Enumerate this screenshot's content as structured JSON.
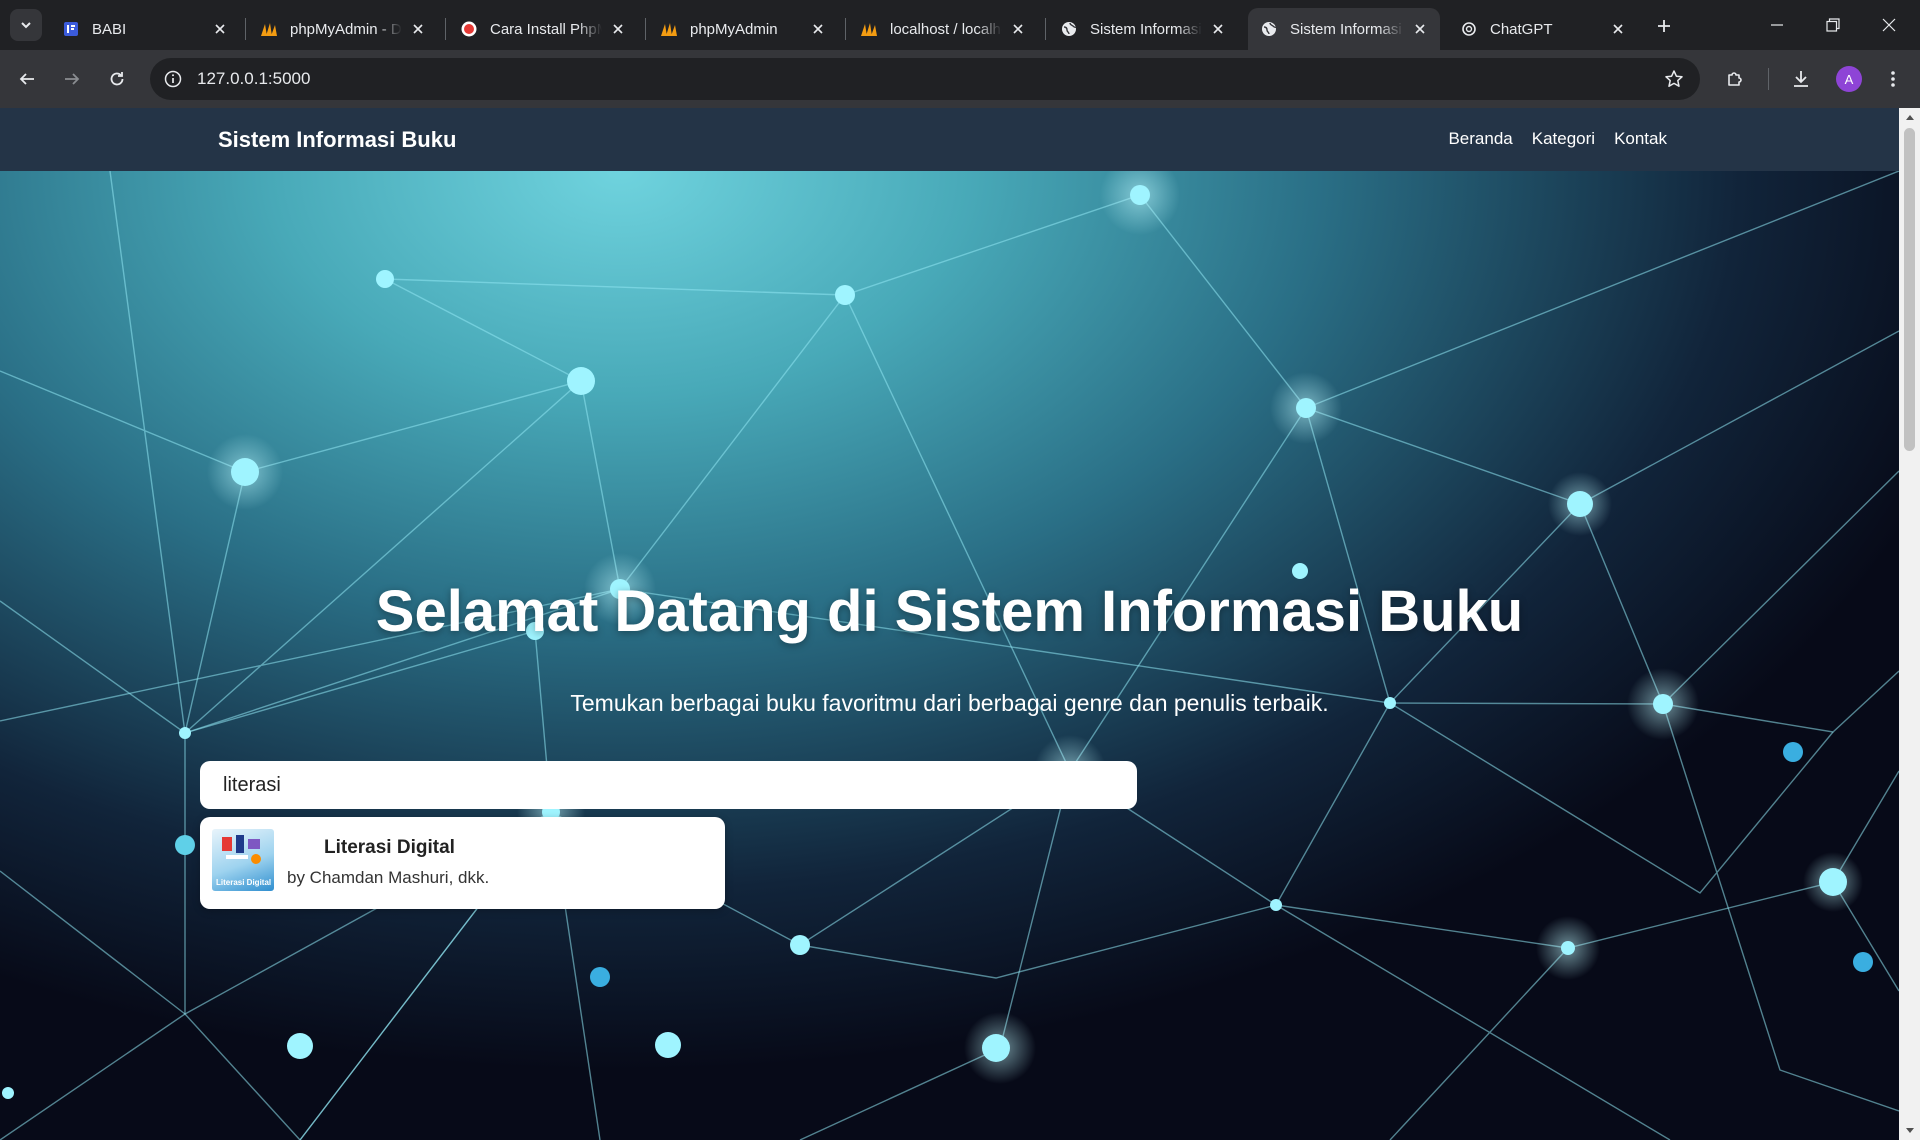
{
  "browser": {
    "tabs": [
      {
        "title": "BABI",
        "favicon": "babi-favicon",
        "active": false
      },
      {
        "title": "phpMyAdmin - D",
        "favicon": "phpmyadmin-favicon",
        "active": false
      },
      {
        "title": "Cara Install PhpMyAdmin",
        "favicon": "article-favicon",
        "active": false
      },
      {
        "title": "phpMyAdmin",
        "favicon": "phpmyadmin-favicon",
        "active": false
      },
      {
        "title": "localhost / localhost",
        "favicon": "phpmyadmin-favicon",
        "active": false
      },
      {
        "title": "Sistem Informasi Buku",
        "favicon": "globe-icon",
        "active": false
      },
      {
        "title": "Sistem Informasi Buku",
        "favicon": "globe-icon",
        "active": true
      },
      {
        "title": "ChatGPT",
        "favicon": "chatgpt-favicon",
        "active": false
      }
    ],
    "url": "127.0.0.1:5000",
    "profile_initial": "A"
  },
  "navbar": {
    "brand": "Sistem Informasi Buku",
    "links": [
      "Beranda",
      "Kategori",
      "Kontak"
    ]
  },
  "hero": {
    "title": "Selamat Datang di Sistem Informasi Buku",
    "subtitle": "Temukan berbagai buku favoritmu dari berbagai genre dan penulis terbaik."
  },
  "search": {
    "value": "literasi"
  },
  "results": [
    {
      "title": "Literasi Digital",
      "author": "by Chamdan Mashuri, dkk.",
      "cover_text": "Literasi Digital"
    }
  ],
  "colors": {
    "navbar_bg": "#243447",
    "hero_light": "#6fd3de",
    "hero_dark": "#070a18",
    "node": "#9ff4ff"
  }
}
